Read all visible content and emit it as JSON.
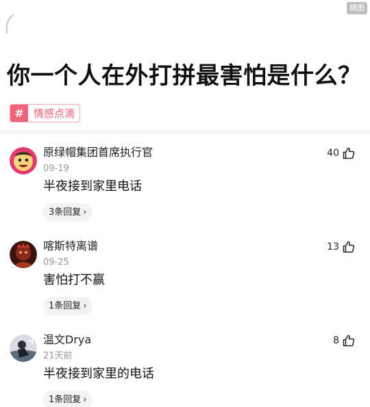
{
  "watermark": "横图",
  "question": {
    "title": "你一个人在外打拼最害怕是什么？",
    "topic": {
      "icon": "hash-icon",
      "label": "情感点滴"
    }
  },
  "colors": {
    "topic_pink": "#ee5c74",
    "topic_badge": "#f0637a",
    "meta_gray": "#999999",
    "pill_bg": "#f3f3f3"
  },
  "comments": [
    {
      "username": "原绿帽集团首席执行官",
      "date": "09-19",
      "text": "半夜接到家里电话",
      "likes": "40",
      "replies": "3条回复",
      "avatar": "cartoon-face-avatar"
    },
    {
      "username": "喀斯特离谱",
      "date": "09-25",
      "text": "害怕打不赢",
      "likes": "13",
      "replies": "1条回复",
      "avatar": "dark-red-character-avatar"
    },
    {
      "username": "温文Drya",
      "date": "21天前",
      "text": "半夜接到家里的电话",
      "likes": "8",
      "replies": "1条回复",
      "avatar": "sketch-figure-avatar"
    }
  ]
}
